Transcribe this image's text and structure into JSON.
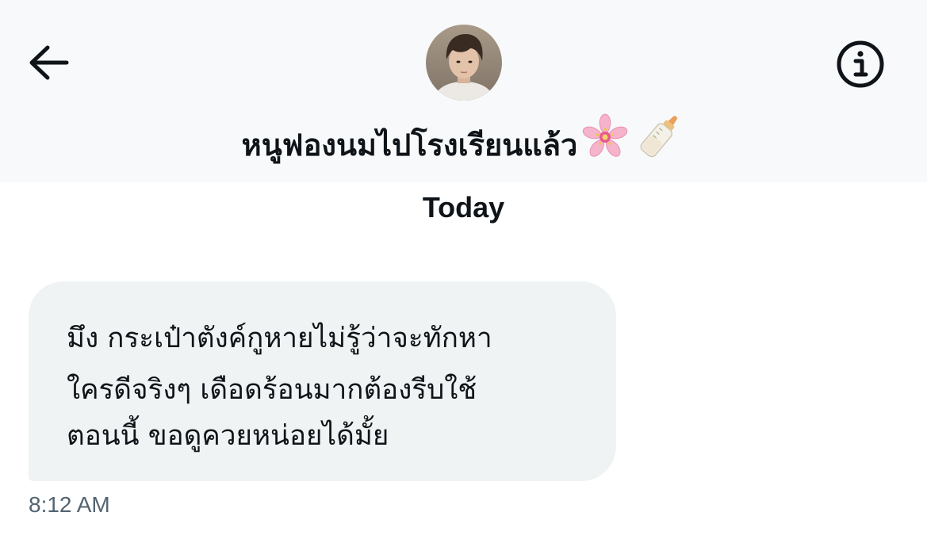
{
  "header": {
    "back_icon": "arrow-left-icon",
    "info_icon": "info-circle-icon",
    "avatar_icon": "user-avatar",
    "title": "หนูฟองนมไปโรงเรียนแล้ว",
    "title_emojis": [
      "cherry-blossom-emoji",
      "baby-bottle-emoji"
    ]
  },
  "conversation": {
    "day_separator": "Today",
    "messages": [
      {
        "lines": [
          "มึง กระเป๋าตังค์กูหายไม่รู้ว่าจะทักหา",
          "ใครดีจริงๆ เดือดร้อนมากต้องรีบใช้",
          "ตอนนี้ ขอดูควยหน่อยได้มั้ย"
        ],
        "time": "8:12 AM"
      }
    ]
  },
  "colors": {
    "header_bg": "#f8f9fa",
    "bubble_bg": "#eff3f4",
    "text": "#0f1419",
    "secondary_text": "#536471"
  }
}
